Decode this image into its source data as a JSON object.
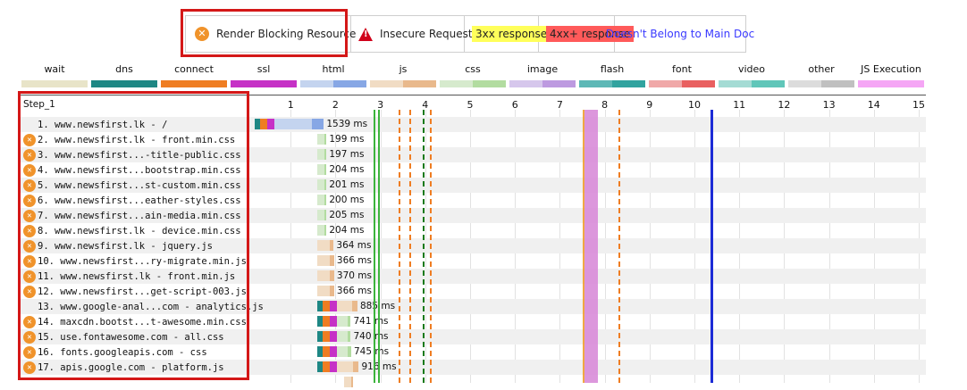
{
  "top_legend": {
    "render_blocking": "Render Blocking Resource",
    "insecure": "Insecure Request",
    "r3xx": "3xx response",
    "r4xx": "4xx+ response",
    "not_main": "Doesn't Belong to Main Doc"
  },
  "type_legend": [
    {
      "label": "wait",
      "color": "#e8e4c8",
      "color2": "#e8e4c8"
    },
    {
      "label": "dns",
      "color": "#1e8784",
      "color2": "#1e8784"
    },
    {
      "label": "connect",
      "color": "#ef7d22",
      "color2": "#ef7d22"
    },
    {
      "label": "ssl",
      "color": "#c631c6",
      "color2": "#c631c6"
    },
    {
      "label": "html",
      "color": "#c4d4ef",
      "color2": "#87a7e5"
    },
    {
      "label": "js",
      "color": "#f1dcc4",
      "color2": "#e9b98c"
    },
    {
      "label": "css",
      "color": "#d6eacd",
      "color2": "#b2dca0"
    },
    {
      "label": "image",
      "color": "#d6c7ec",
      "color2": "#bd9ae0"
    },
    {
      "label": "flash",
      "color": "#5db8b6",
      "color2": "#31a39f"
    },
    {
      "label": "font",
      "color": "#f0a8a8",
      "color2": "#e96060"
    },
    {
      "label": "video",
      "color": "#a4dbd4",
      "color2": "#60c6b9"
    },
    {
      "label": "other",
      "color": "#dcdcdc",
      "color2": "#c0c0c0"
    },
    {
      "label": "JS Execution",
      "color": "#f5a6f5",
      "color2": "#f5a6f5"
    }
  ],
  "step_label": "Step_1",
  "ticks": [
    "1",
    "2",
    "3",
    "4",
    "5",
    "6",
    "7",
    "8",
    "9",
    "10",
    "11",
    "12",
    "13",
    "14",
    "15"
  ],
  "rows": [
    {
      "label": "1. www.newsfirst.lk - /",
      "rb": false,
      "ms": "1539 ms",
      "start": 0.2,
      "dur": 1.54,
      "type": "html",
      "conn": true
    },
    {
      "label": "2. www.newsfirst.lk - front.min.css",
      "rb": true,
      "ms": "199 ms",
      "start": 1.6,
      "dur": 0.2,
      "type": "css",
      "conn": false
    },
    {
      "label": "3. www.newsfirst...-title-public.css",
      "rb": true,
      "ms": "197 ms",
      "start": 1.6,
      "dur": 0.2,
      "type": "css",
      "conn": false
    },
    {
      "label": "4. www.newsfirst...bootstrap.min.css",
      "rb": true,
      "ms": "204 ms",
      "start": 1.6,
      "dur": 0.2,
      "type": "css",
      "conn": false
    },
    {
      "label": "5. www.newsfirst...st-custom.min.css",
      "rb": true,
      "ms": "201 ms",
      "start": 1.6,
      "dur": 0.2,
      "type": "css",
      "conn": false
    },
    {
      "label": "6. www.newsfirst...eather-styles.css",
      "rb": true,
      "ms": "200 ms",
      "start": 1.6,
      "dur": 0.2,
      "type": "css",
      "conn": false
    },
    {
      "label": "7. www.newsfirst...ain-media.min.css",
      "rb": true,
      "ms": "205 ms",
      "start": 1.6,
      "dur": 0.2,
      "type": "css",
      "conn": false
    },
    {
      "label": "8. www.newsfirst.lk - device.min.css",
      "rb": true,
      "ms": "204 ms",
      "start": 1.6,
      "dur": 0.2,
      "type": "css",
      "conn": false
    },
    {
      "label": "9. www.newsfirst.lk - jquery.js",
      "rb": true,
      "ms": "364 ms",
      "start": 1.6,
      "dur": 0.36,
      "type": "js",
      "conn": false
    },
    {
      "label": "10. www.newsfirst...ry-migrate.min.js",
      "rb": true,
      "ms": "366 ms",
      "start": 1.6,
      "dur": 0.37,
      "type": "js",
      "conn": false
    },
    {
      "label": "11. www.newsfirst.lk - front.min.js",
      "rb": true,
      "ms": "370 ms",
      "start": 1.6,
      "dur": 0.37,
      "type": "js",
      "conn": false
    },
    {
      "label": "12. www.newsfirst...get-script-003.js",
      "rb": true,
      "ms": "366 ms",
      "start": 1.6,
      "dur": 0.37,
      "type": "js",
      "conn": false
    },
    {
      "label": "13. www.google-anal...com - analytics.js",
      "rb": false,
      "ms": "885 ms",
      "start": 1.6,
      "dur": 0.89,
      "type": "js",
      "conn": true
    },
    {
      "label": "14. maxcdn.bootst...t-awesome.min.css",
      "rb": true,
      "ms": "741 ms",
      "start": 1.6,
      "dur": 0.74,
      "type": "css",
      "conn": true
    },
    {
      "label": "15. use.fontawesome.com - all.css",
      "rb": true,
      "ms": "740 ms",
      "start": 1.6,
      "dur": 0.74,
      "type": "css",
      "conn": true
    },
    {
      "label": "16. fonts.googleapis.com - css",
      "rb": true,
      "ms": "745 ms",
      "start": 1.6,
      "dur": 0.75,
      "type": "css",
      "conn": true
    },
    {
      "label": "17. apis.google.com - platform.js",
      "rb": true,
      "ms": "916 ms",
      "start": 1.6,
      "dur": 0.92,
      "type": "js",
      "conn": true
    },
    {
      "label": "",
      "rb": false,
      "ms": "",
      "start": 2.2,
      "dur": 0.2,
      "type": "js",
      "conn": false
    }
  ],
  "markers": [
    {
      "t": 2.85,
      "color": "#3cb43c",
      "style": "solid",
      "width": 2
    },
    {
      "t": 2.95,
      "color": "#3cb43c",
      "style": "solid",
      "width": 2
    },
    {
      "t": 3.4,
      "color": "#ef7d22",
      "style": "dashed",
      "width": 2
    },
    {
      "t": 3.65,
      "color": "#ef7d22",
      "style": "dashed",
      "width": 2
    },
    {
      "t": 3.95,
      "color": "#1a7a1a",
      "style": "dashed",
      "width": 2
    },
    {
      "t": 4.1,
      "color": "#ef7d22",
      "style": "dashed",
      "width": 2
    },
    {
      "t": 8.3,
      "color": "#ef7d22",
      "style": "dashed",
      "width": 2
    },
    {
      "t": 10.35,
      "color": "#1c2bd6",
      "style": "solid",
      "width": 3
    }
  ],
  "js_exec_band": {
    "t": 7.5,
    "width": 0.3,
    "color": "#d98cd9",
    "edge": "#f0a030"
  }
}
